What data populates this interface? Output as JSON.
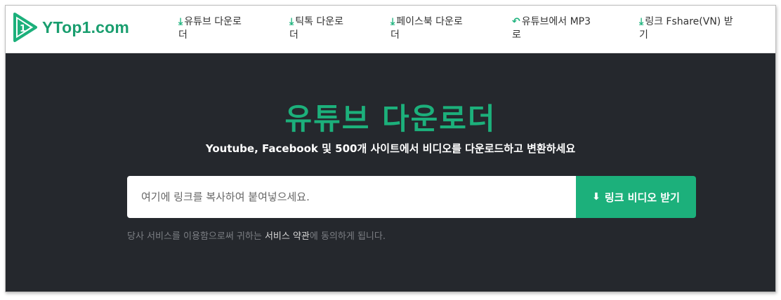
{
  "logo": {
    "text": "YTop1.com",
    "badge": "1"
  },
  "nav": [
    {
      "icon": "download-icon",
      "glyph": "⤓",
      "line1": "유튜브 다운로",
      "line2": "더"
    },
    {
      "icon": "download-icon",
      "glyph": "⤓",
      "line1": "틱톡 다운로",
      "line2": "더"
    },
    {
      "icon": "download-icon",
      "glyph": "⤓",
      "line1": "페이스북 다운로",
      "line2": "더"
    },
    {
      "icon": "convert-icon",
      "glyph": "↶",
      "line1": "유튜브에서 MP3",
      "line2": "로"
    },
    {
      "icon": "download-icon",
      "glyph": "⤓",
      "line1": "링크 Fshare(VN) 받",
      "line2": "기"
    }
  ],
  "hero": {
    "title": "유튜브 다운로더",
    "subtitle": "Youtube, Facebook 및 500개 사이트에서 비디오를 다운로드하고 변환하세요"
  },
  "search": {
    "placeholder": "여기에 링크를 복사하여 붙여넣으세요.",
    "value": "",
    "button_label": "링크 비디오 받기",
    "button_icon": "download-icon"
  },
  "terms": {
    "prefix": "당사 서비스를 이용함으로써 귀하는 ",
    "link": "서비스 약관",
    "suffix": "에 동의하게 됩니다."
  },
  "colors": {
    "brand_green": "#1cb07b",
    "hero_bg": "#25282d"
  }
}
